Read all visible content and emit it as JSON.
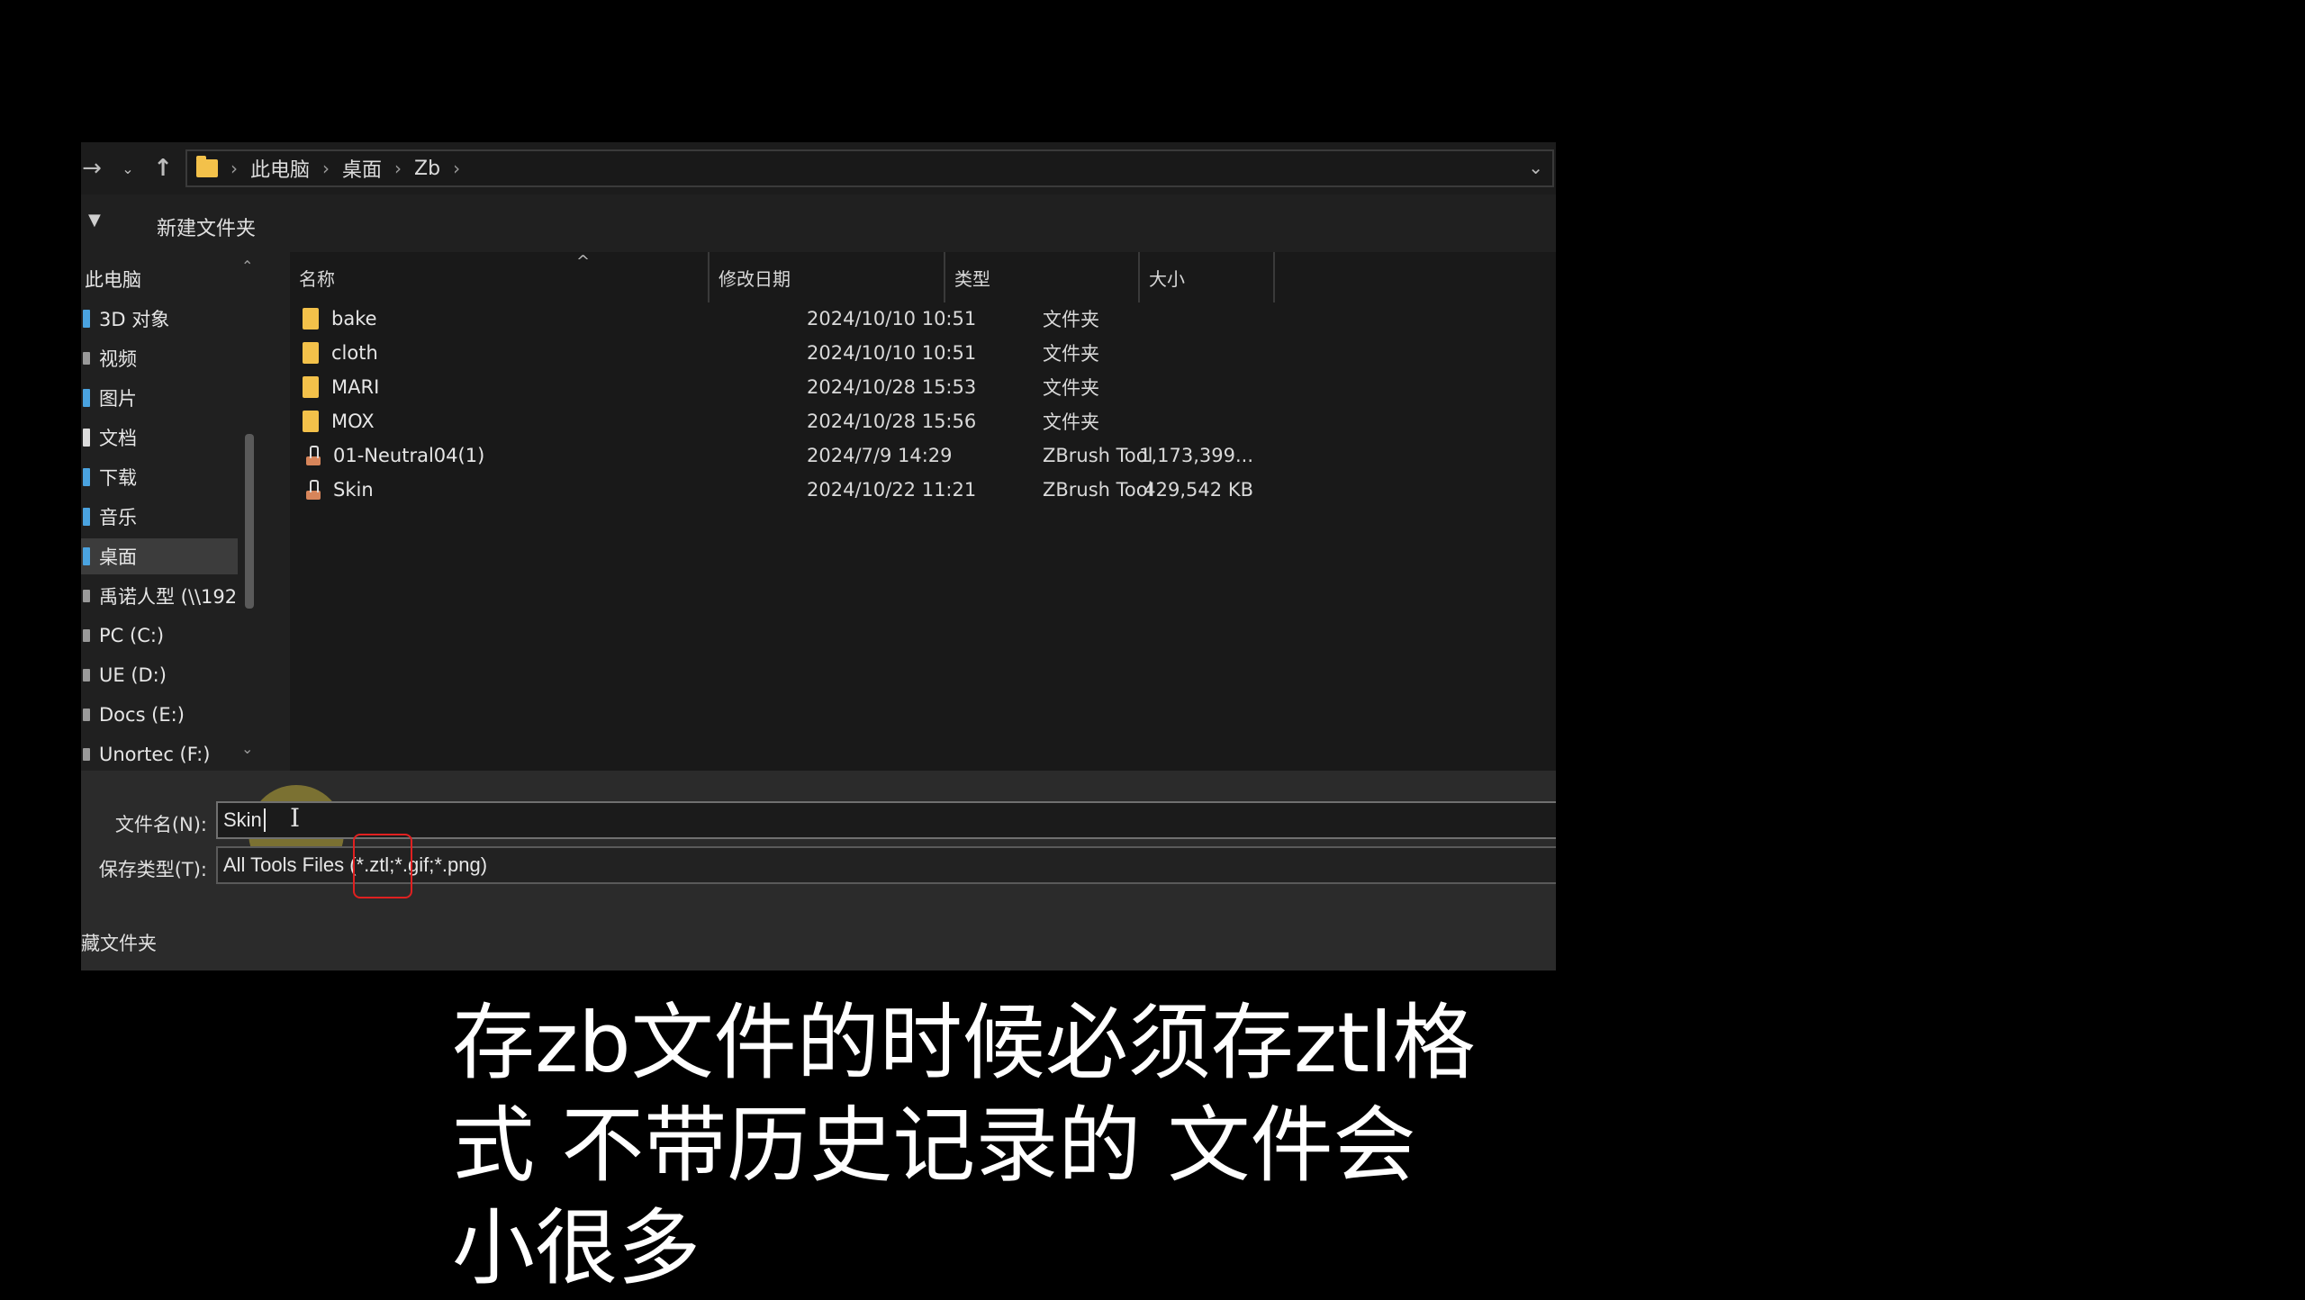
{
  "breadcrumbs": [
    "此电脑",
    "桌面",
    "Zb"
  ],
  "toolbar": {
    "new_folder": "新建文件夹"
  },
  "sidebar": {
    "header": "此电脑",
    "items": [
      {
        "label": "3D 对象"
      },
      {
        "label": "视频"
      },
      {
        "label": "图片"
      },
      {
        "label": "文档"
      },
      {
        "label": "下载"
      },
      {
        "label": "音乐"
      },
      {
        "label": "桌面",
        "selected": true
      },
      {
        "label": "禹诺人型 (\\\\192"
      },
      {
        "label": "PC (C:)"
      },
      {
        "label": "UE (D:)"
      },
      {
        "label": "Docs (E:)"
      },
      {
        "label": "Unortec (F:)"
      }
    ]
  },
  "columns": {
    "name": "名称",
    "date": "修改日期",
    "type": "类型",
    "size": "大小"
  },
  "files": [
    {
      "name": "bake",
      "date": "2024/10/10 10:51",
      "type": "文件夹",
      "size": "",
      "icon": "folder"
    },
    {
      "name": "cloth",
      "date": "2024/10/10 10:51",
      "type": "文件夹",
      "size": "",
      "icon": "folder"
    },
    {
      "name": "MARI",
      "date": "2024/10/28 15:53",
      "type": "文件夹",
      "size": "",
      "icon": "folder"
    },
    {
      "name": "MOX",
      "date": "2024/10/28 15:56",
      "type": "文件夹",
      "size": "",
      "icon": "folder"
    },
    {
      "name": "01-Neutral04(1)",
      "date": "2024/7/9 14:29",
      "type": "ZBrush Tool",
      "size": "1,173,399...",
      "icon": "zbrush-tool"
    },
    {
      "name": "Skin",
      "date": "2024/10/22 11:21",
      "type": "ZBrush Tool",
      "size": "429,542 KB",
      "icon": "zbrush-tool"
    }
  ],
  "save": {
    "filename_label": "文件名(N):",
    "filename_value": "Skin",
    "filetype_label": "保存类型(T):",
    "filetype_value": "All Tools Files (*.ztl;*.gif;*.png)",
    "hide_folders": "藏文件夹"
  },
  "subtitle": "存zb文件的时候必须存ztl格\n式 不带历史记录的 文件会\n小很多",
  "colors": {
    "folder": "#f3c14a",
    "highlight": "#e02020",
    "cursor": "#dec83c"
  }
}
